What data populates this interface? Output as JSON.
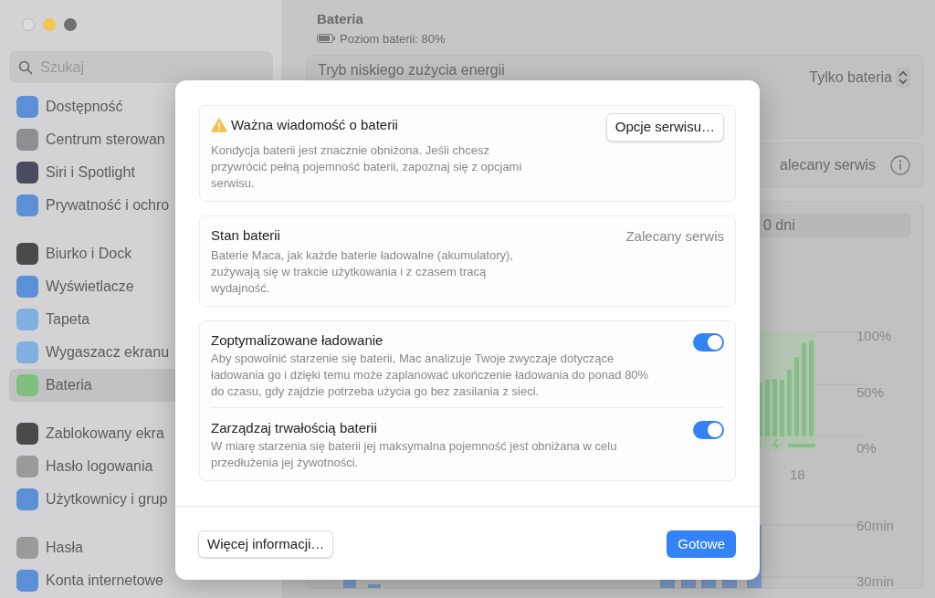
{
  "sidebar": {
    "search": {
      "placeholder": "Szukaj"
    },
    "groups": [
      [
        {
          "label": "Dostępność",
          "color": "#5b8fd6",
          "selected": false
        },
        {
          "label": "Centrum sterowan",
          "color": "#8e8e93",
          "selected": false
        },
        {
          "label": "Siri i Spotlight",
          "color": "#4a4a60",
          "selected": false
        },
        {
          "label": "Prywatność i ochro",
          "color": "#5b8fd6",
          "selected": false
        }
      ],
      [
        {
          "label": "Biurko i Dock",
          "color": "#4a4a4a",
          "selected": false
        },
        {
          "label": "Wyświetlacze",
          "color": "#5b8fd6",
          "selected": false
        },
        {
          "label": "Tapeta",
          "color": "#7fb0e0",
          "selected": false
        },
        {
          "label": "Wygaszacz ekranu",
          "color": "#7fb0e0",
          "selected": false
        },
        {
          "label": "Bateria",
          "color": "#7fbf7f",
          "selected": true
        }
      ],
      [
        {
          "label": "Zablokowany ekra",
          "color": "#4a4a4a",
          "selected": false
        },
        {
          "label": "Hasło logowania",
          "color": "#9a9a9a",
          "selected": false
        },
        {
          "label": "Użytkownicy i grup",
          "color": "#5b8fd6",
          "selected": false
        }
      ],
      [
        {
          "label": "Hasła",
          "color": "#9a9a9a",
          "selected": false
        },
        {
          "label": "Konta internetowe",
          "color": "#5b8fd6",
          "selected": false
        }
      ]
    ]
  },
  "main": {
    "title": "Bateria",
    "battery_level_text": "Poziom baterii: 80%",
    "low_power": {
      "label": "Tryb niskiego zużycia energii",
      "value": "Tylko bateria"
    },
    "health": {
      "value": "alecany serwis"
    },
    "range": {
      "label": "0 dni"
    },
    "level_axis": [
      "100%",
      "50%",
      "0%"
    ],
    "time_axis": [
      "18"
    ],
    "usage_axis": [
      "60min",
      "30min"
    ]
  },
  "dialog": {
    "sections": [
      {
        "kind": "notice",
        "title": "Ważna wiadomość o baterii",
        "description": "Kondycja baterii jest znacznie obniżona. Jeśli chcesz przywrócić pełną pojemność baterii, zapoznaj się z opcjami serwisu.",
        "button": "Opcje serwisu…"
      },
      {
        "kind": "status",
        "title": "Stan baterii",
        "value": "Zalecany serwis",
        "description": "Baterie Maca, jak każde baterie ładowalne (akumulatory), zużywają się w trakcie użytkowania i z czasem tracą wydajność."
      },
      {
        "kind": "toggles",
        "rows": [
          {
            "title": "Zoptymalizowane ładowanie",
            "description": "Aby spowolnić starzenie się baterii, Mac analizuje Twoje zwyczaje dotyczące ładowania go i dzięki temu może zaplanować ukończenie ładowania do ponad 80% do czasu, gdy zajdzie potrzeba użycia go bez zasilania z sieci.",
            "on": true
          },
          {
            "title": "Zarządzaj trwałością baterii",
            "description": "W miarę starzenia się baterii jej maksymalna pojemność jest obniżana w celu przedłużenia jej żywotności.",
            "on": true
          }
        ]
      }
    ],
    "secondary_button": "Więcej informacji…",
    "primary_button": "Gotowe"
  }
}
